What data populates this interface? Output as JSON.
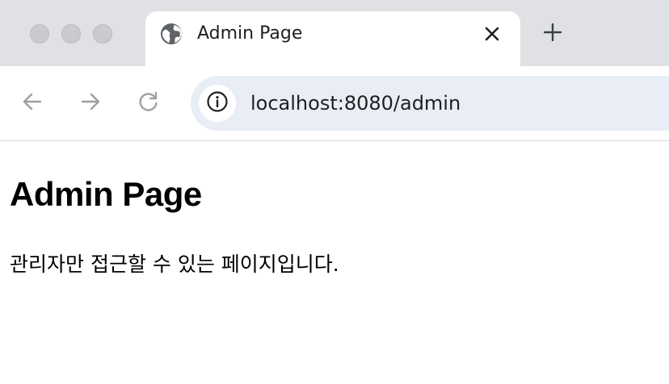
{
  "window": {
    "traffic_lights": [
      "close",
      "minimize",
      "zoom"
    ]
  },
  "tab": {
    "favicon": "globe-icon",
    "title": "Admin Page",
    "close_icon": "close-icon"
  },
  "new_tab_icon": "plus-icon",
  "toolbar": {
    "back_icon": "arrow-left-icon",
    "forward_icon": "arrow-right-icon",
    "reload_icon": "reload-icon",
    "site_info_icon": "info-icon",
    "url": "localhost:8080/admin"
  },
  "page": {
    "heading": "Admin Page",
    "text": "관리자만 접근할 수 있는 페이지입니다."
  },
  "colors": {
    "tabbar_bg": "#dfe1e5",
    "omnibox_bg": "#e9edf6",
    "disabled_icon": "#9aa0a6"
  }
}
